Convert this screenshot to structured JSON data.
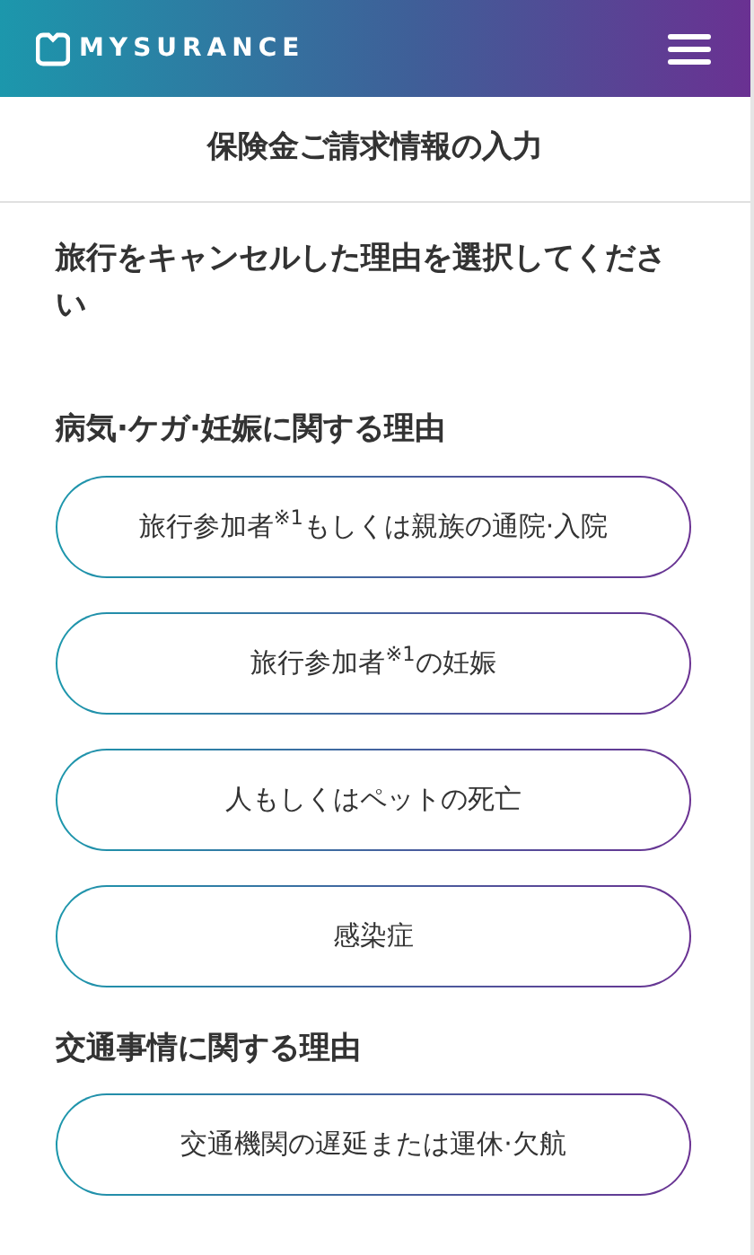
{
  "header": {
    "logo_text": "MYSURANCE"
  },
  "page_title": "保険金ご請求情報の入力",
  "question": "旅行をキャンセルした理由を選択してください",
  "sections": [
    {
      "heading": "病気·ケガ·妊娠に関する理由",
      "options": [
        "旅行参加者$^{※1}$もしくは親族の通院·入院",
        "旅行参加者$^{※1}$の妊娠",
        "人もしくはペットの死亡",
        "感染症"
      ]
    },
    {
      "heading": "交通事情に関する理由",
      "options": [
        "交通機関の遅延または運休·欠航"
      ]
    }
  ]
}
